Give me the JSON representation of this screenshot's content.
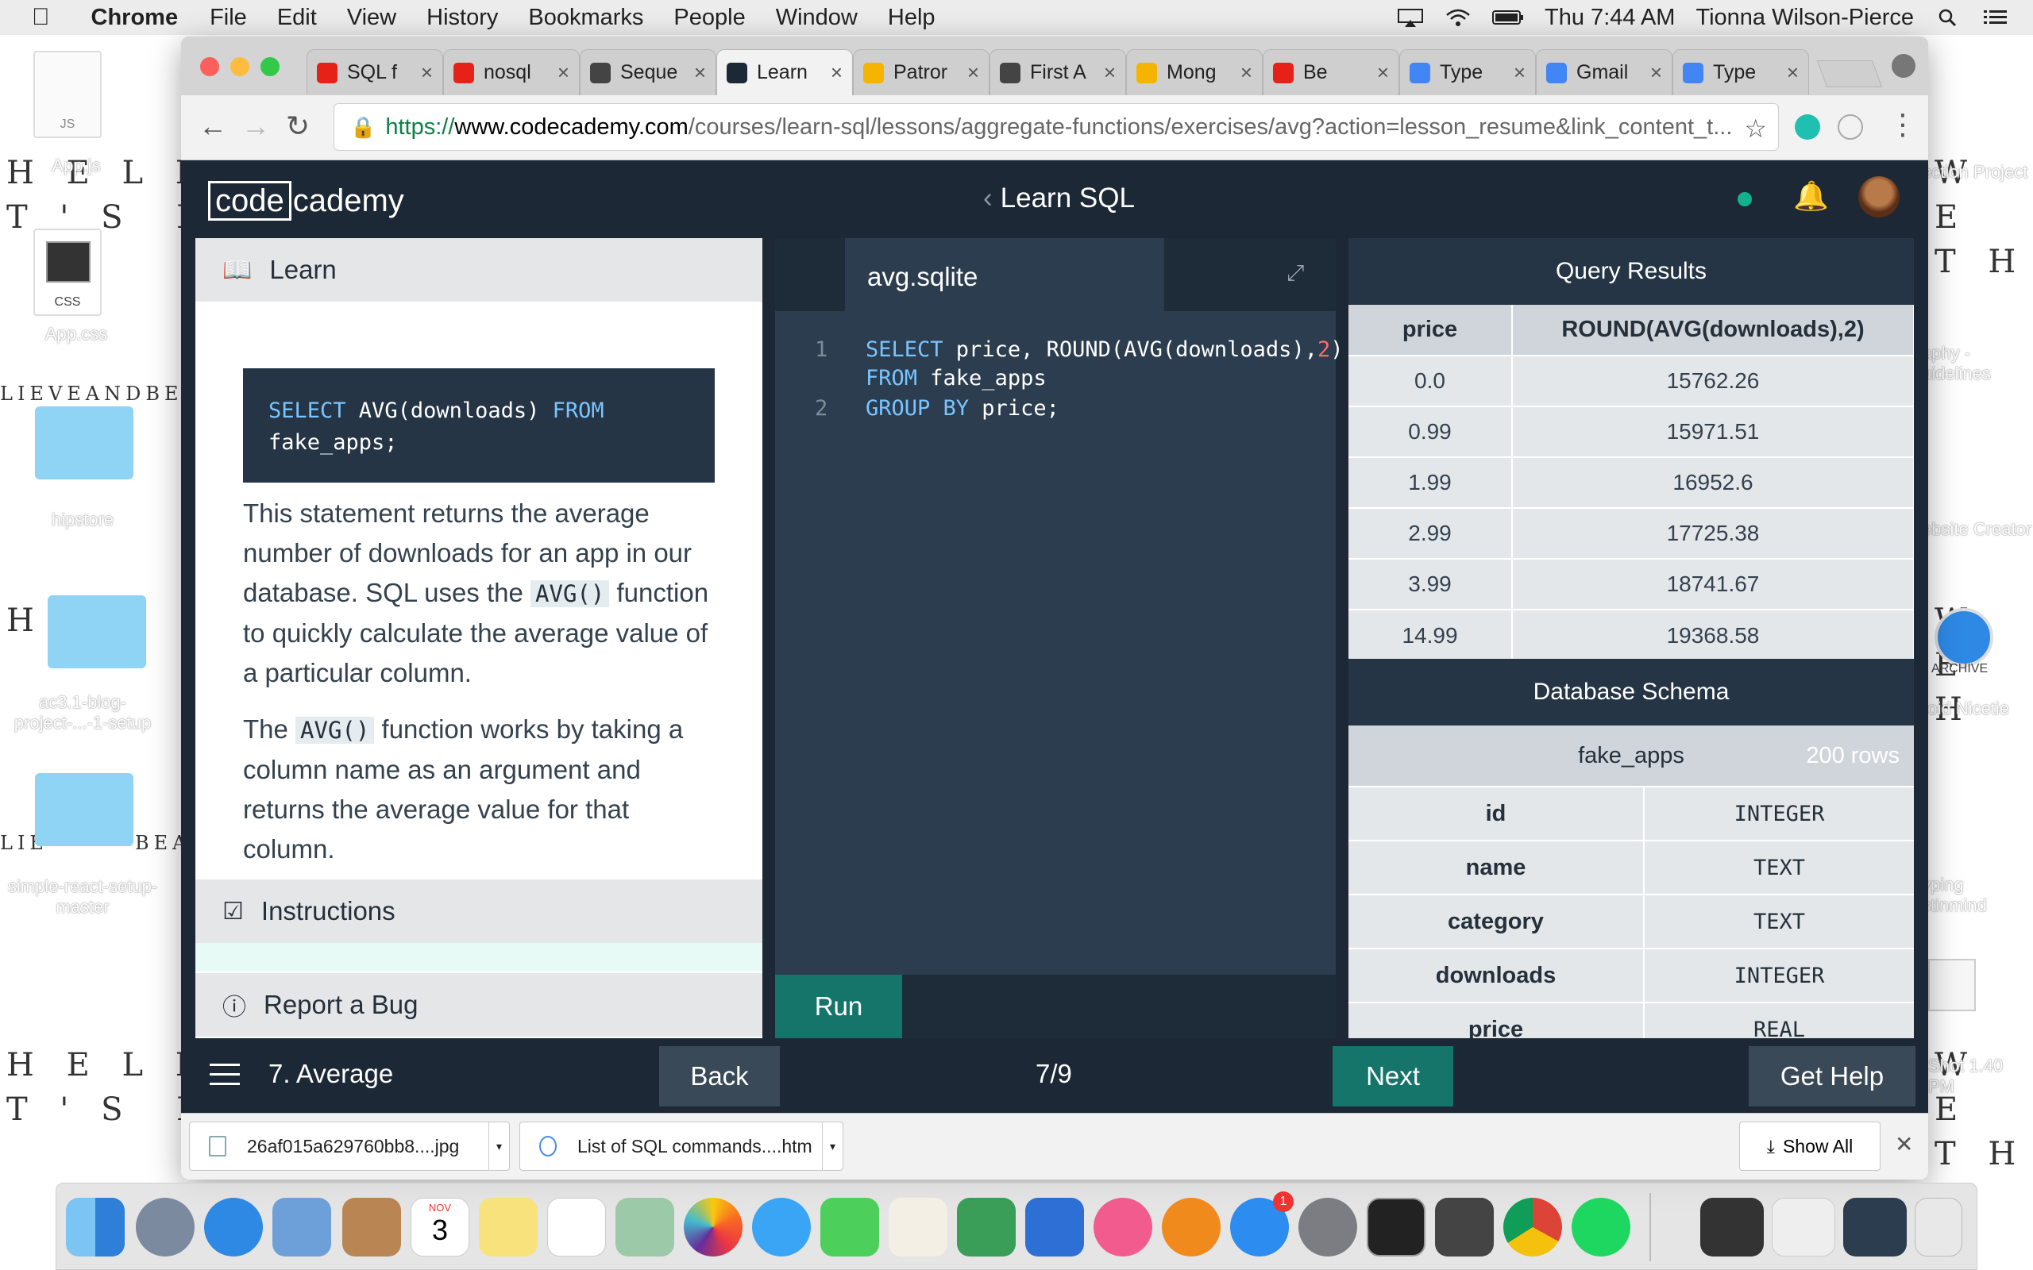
{
  "menubar": {
    "app": "Chrome",
    "items": [
      "File",
      "Edit",
      "View",
      "History",
      "Bookmarks",
      "People",
      "Window",
      "Help"
    ],
    "clock": "Thu 7:44 AM",
    "user": "Tionna Wilson-Pierce"
  },
  "desktop": {
    "items": [
      "App.js",
      "App.css",
      "hipstore",
      "ac3.1-blog-project-...-1-setup",
      "simple-react-setup-master"
    ],
    "right_items": [
      "ection Project",
      "aphy - uidelines",
      "ebsite Creator",
      "ARCHIVE",
      "roid Nicetie",
      "yping stinmind",
      "Shot 1.40 PM"
    ],
    "file_tags": {
      "js": "JS",
      "css": "CSS"
    }
  },
  "browser": {
    "tabs": [
      {
        "title": "SQL f",
        "color": "#e62117"
      },
      {
        "title": "nosql",
        "color": "#e62117"
      },
      {
        "title": "Seque",
        "color": "#444"
      },
      {
        "title": "Learn",
        "color": "#1c2836"
      },
      {
        "title": "Patror",
        "color": "#f5b400"
      },
      {
        "title": "First A",
        "color": "#444"
      },
      {
        "title": "Mong",
        "color": "#f5b400"
      },
      {
        "title": "Be",
        "color": "#e62117"
      },
      {
        "title": "Type",
        "color": "#4285f4"
      },
      {
        "title": "Gmail",
        "color": "#4285f4"
      },
      {
        "title": "Type",
        "color": "#4285f4"
      }
    ],
    "url_scheme": "https://",
    "url_host": "www.codecademy.com",
    "url_path": "/courses/learn-sql/lessons/aggregate-functions/exercises/avg?action=lesson_resume&link_content_t..."
  },
  "codecademy": {
    "logo_box": "code",
    "logo_rest": "cademy",
    "course_title": "Learn SQL",
    "learn_header": "Learn",
    "example_code": {
      "kw1": "SELECT",
      "mid": " AVG(downloads) ",
      "kw2": "FROM",
      "line2": "fake_apps;"
    },
    "para1": {
      "a": "This statement returns the average number of downloads for an app in our database. SQL uses the ",
      "code": "AVG()",
      "b": " function to quickly calculate the average value of a particular column."
    },
    "para2": {
      "a": "The ",
      "code": "AVG()",
      "b": " function works by taking a column name as an argument and returns the average value for that column."
    },
    "instructions_header": "Instructions",
    "bug_header": "Report a Bug",
    "editor_filename": "avg.sqlite",
    "code_lines": [
      {
        "no": "1",
        "kw": "SELECT",
        "rest": " price, ROUND(AVG(downloads),",
        "num": "2",
        "end": ")"
      },
      {
        "no": "",
        "kw": "FROM",
        "rest": " fake_apps",
        "num": "",
        "end": ""
      },
      {
        "no": "2",
        "kw": "GROUP BY",
        "rest": " price;",
        "num": "",
        "end": ""
      }
    ],
    "run_label": "Run",
    "results_title": "Query Results",
    "result_columns": [
      "price",
      "ROUND(AVG(downloads),2)"
    ],
    "result_rows": [
      [
        "0.0",
        "15762.26"
      ],
      [
        "0.99",
        "15971.51"
      ],
      [
        "1.99",
        "16952.6"
      ],
      [
        "2.99",
        "17725.38"
      ],
      [
        "3.99",
        "18741.67"
      ],
      [
        "14.99",
        "19368.58"
      ]
    ],
    "schema_title": "Database Schema",
    "schema_table": "fake_apps",
    "schema_rows_count": "200 rows",
    "schema_columns": [
      [
        "id",
        "INTEGER"
      ],
      [
        "name",
        "TEXT"
      ],
      [
        "category",
        "TEXT"
      ],
      [
        "downloads",
        "INTEGER"
      ],
      [
        "price",
        "REAL"
      ]
    ],
    "lesson_label": "7. Average",
    "back_label": "Back",
    "pager": "7/9",
    "next_label": "Next",
    "help_label": "Get Help"
  },
  "downloads": {
    "items": [
      "26af015a629760bb8....jpg",
      "List of SQL commands....htm"
    ],
    "show_all": "Show All"
  },
  "dock": {
    "calendar_month": "NOV",
    "calendar_day": "3",
    "badge": "1"
  },
  "colors": {
    "accent": "#15756b",
    "brand_dark": "#1c2836",
    "panel": "#253545"
  }
}
